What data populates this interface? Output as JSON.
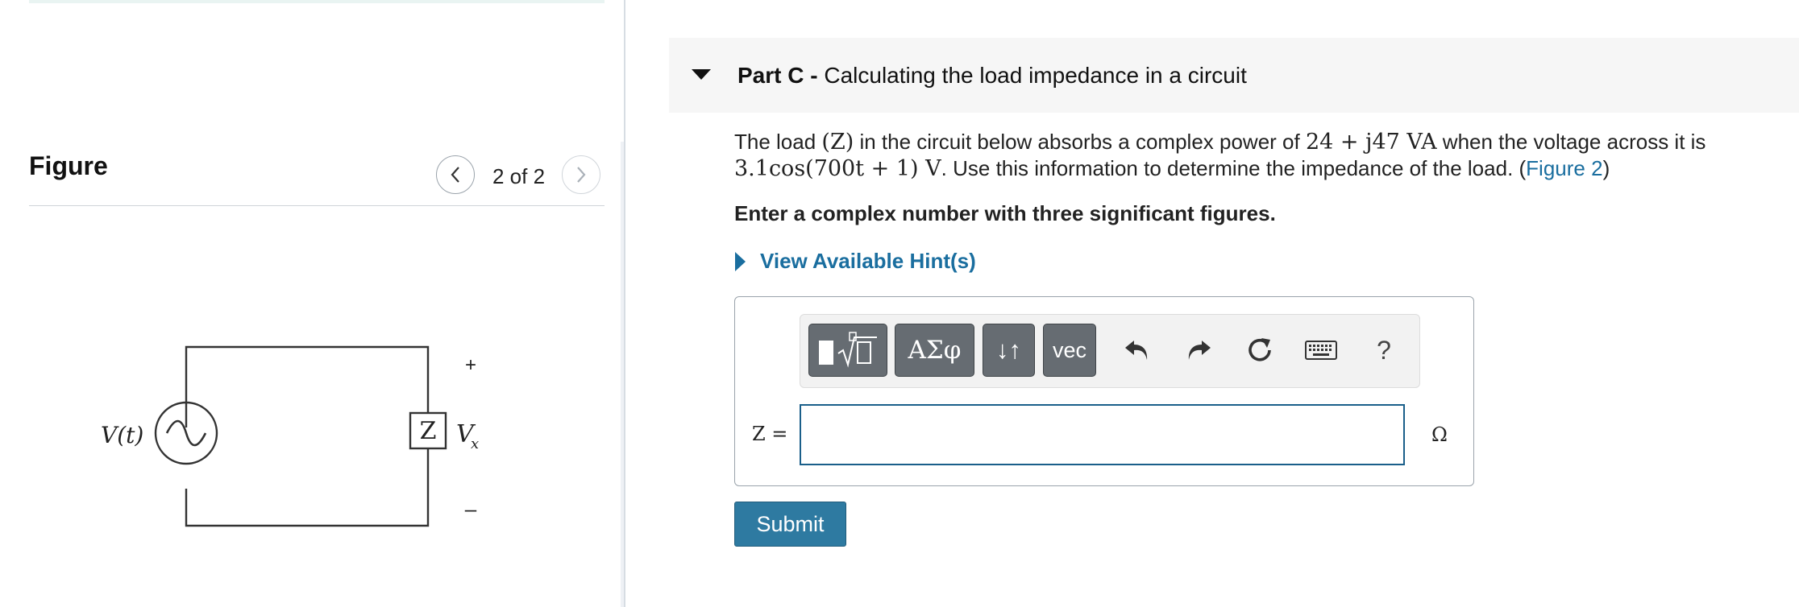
{
  "figure_panel": {
    "title": "Figure",
    "counter": "2 of 2",
    "circuit": {
      "source_label": "V(t)",
      "load_label": "Z",
      "voltage_label": "V",
      "voltage_subscript": "x",
      "plus_sign": "+",
      "minus_sign": "–"
    }
  },
  "question": {
    "part_prefix": "Part C -",
    "part_title": " Calculating the load impedance in a circuit",
    "prompt": {
      "t1": "The load ",
      "m1": "(Z)",
      "t2": " in the circuit below absorbs a complex power of ",
      "m2": "24 + j47 VA",
      "t3": " when the voltage across it is ",
      "m3": "3.1cos(700t + 1) V",
      "t4": ".  Use this information to determine the impedance of the load. (",
      "figure_link": "Figure 2",
      "t5": ")"
    },
    "instruction": "Enter a complex number with three significant figures.",
    "hint_link": "View Available Hint(s)"
  },
  "answer": {
    "toolbar": {
      "templates_icon": "templates-sqrt-icon",
      "greek_label": "ΑΣφ",
      "arrows_label": "↓↑",
      "vec_label": "vec",
      "help_label": "?"
    },
    "input_label": "Z =",
    "input_value": "",
    "unit": "Ω",
    "submit_label": "Submit"
  },
  "colors": {
    "link": "#1a6e9f",
    "submit": "#2e7aa1",
    "toolbar_button": "#666c72",
    "input_border": "#1a5f8a"
  }
}
